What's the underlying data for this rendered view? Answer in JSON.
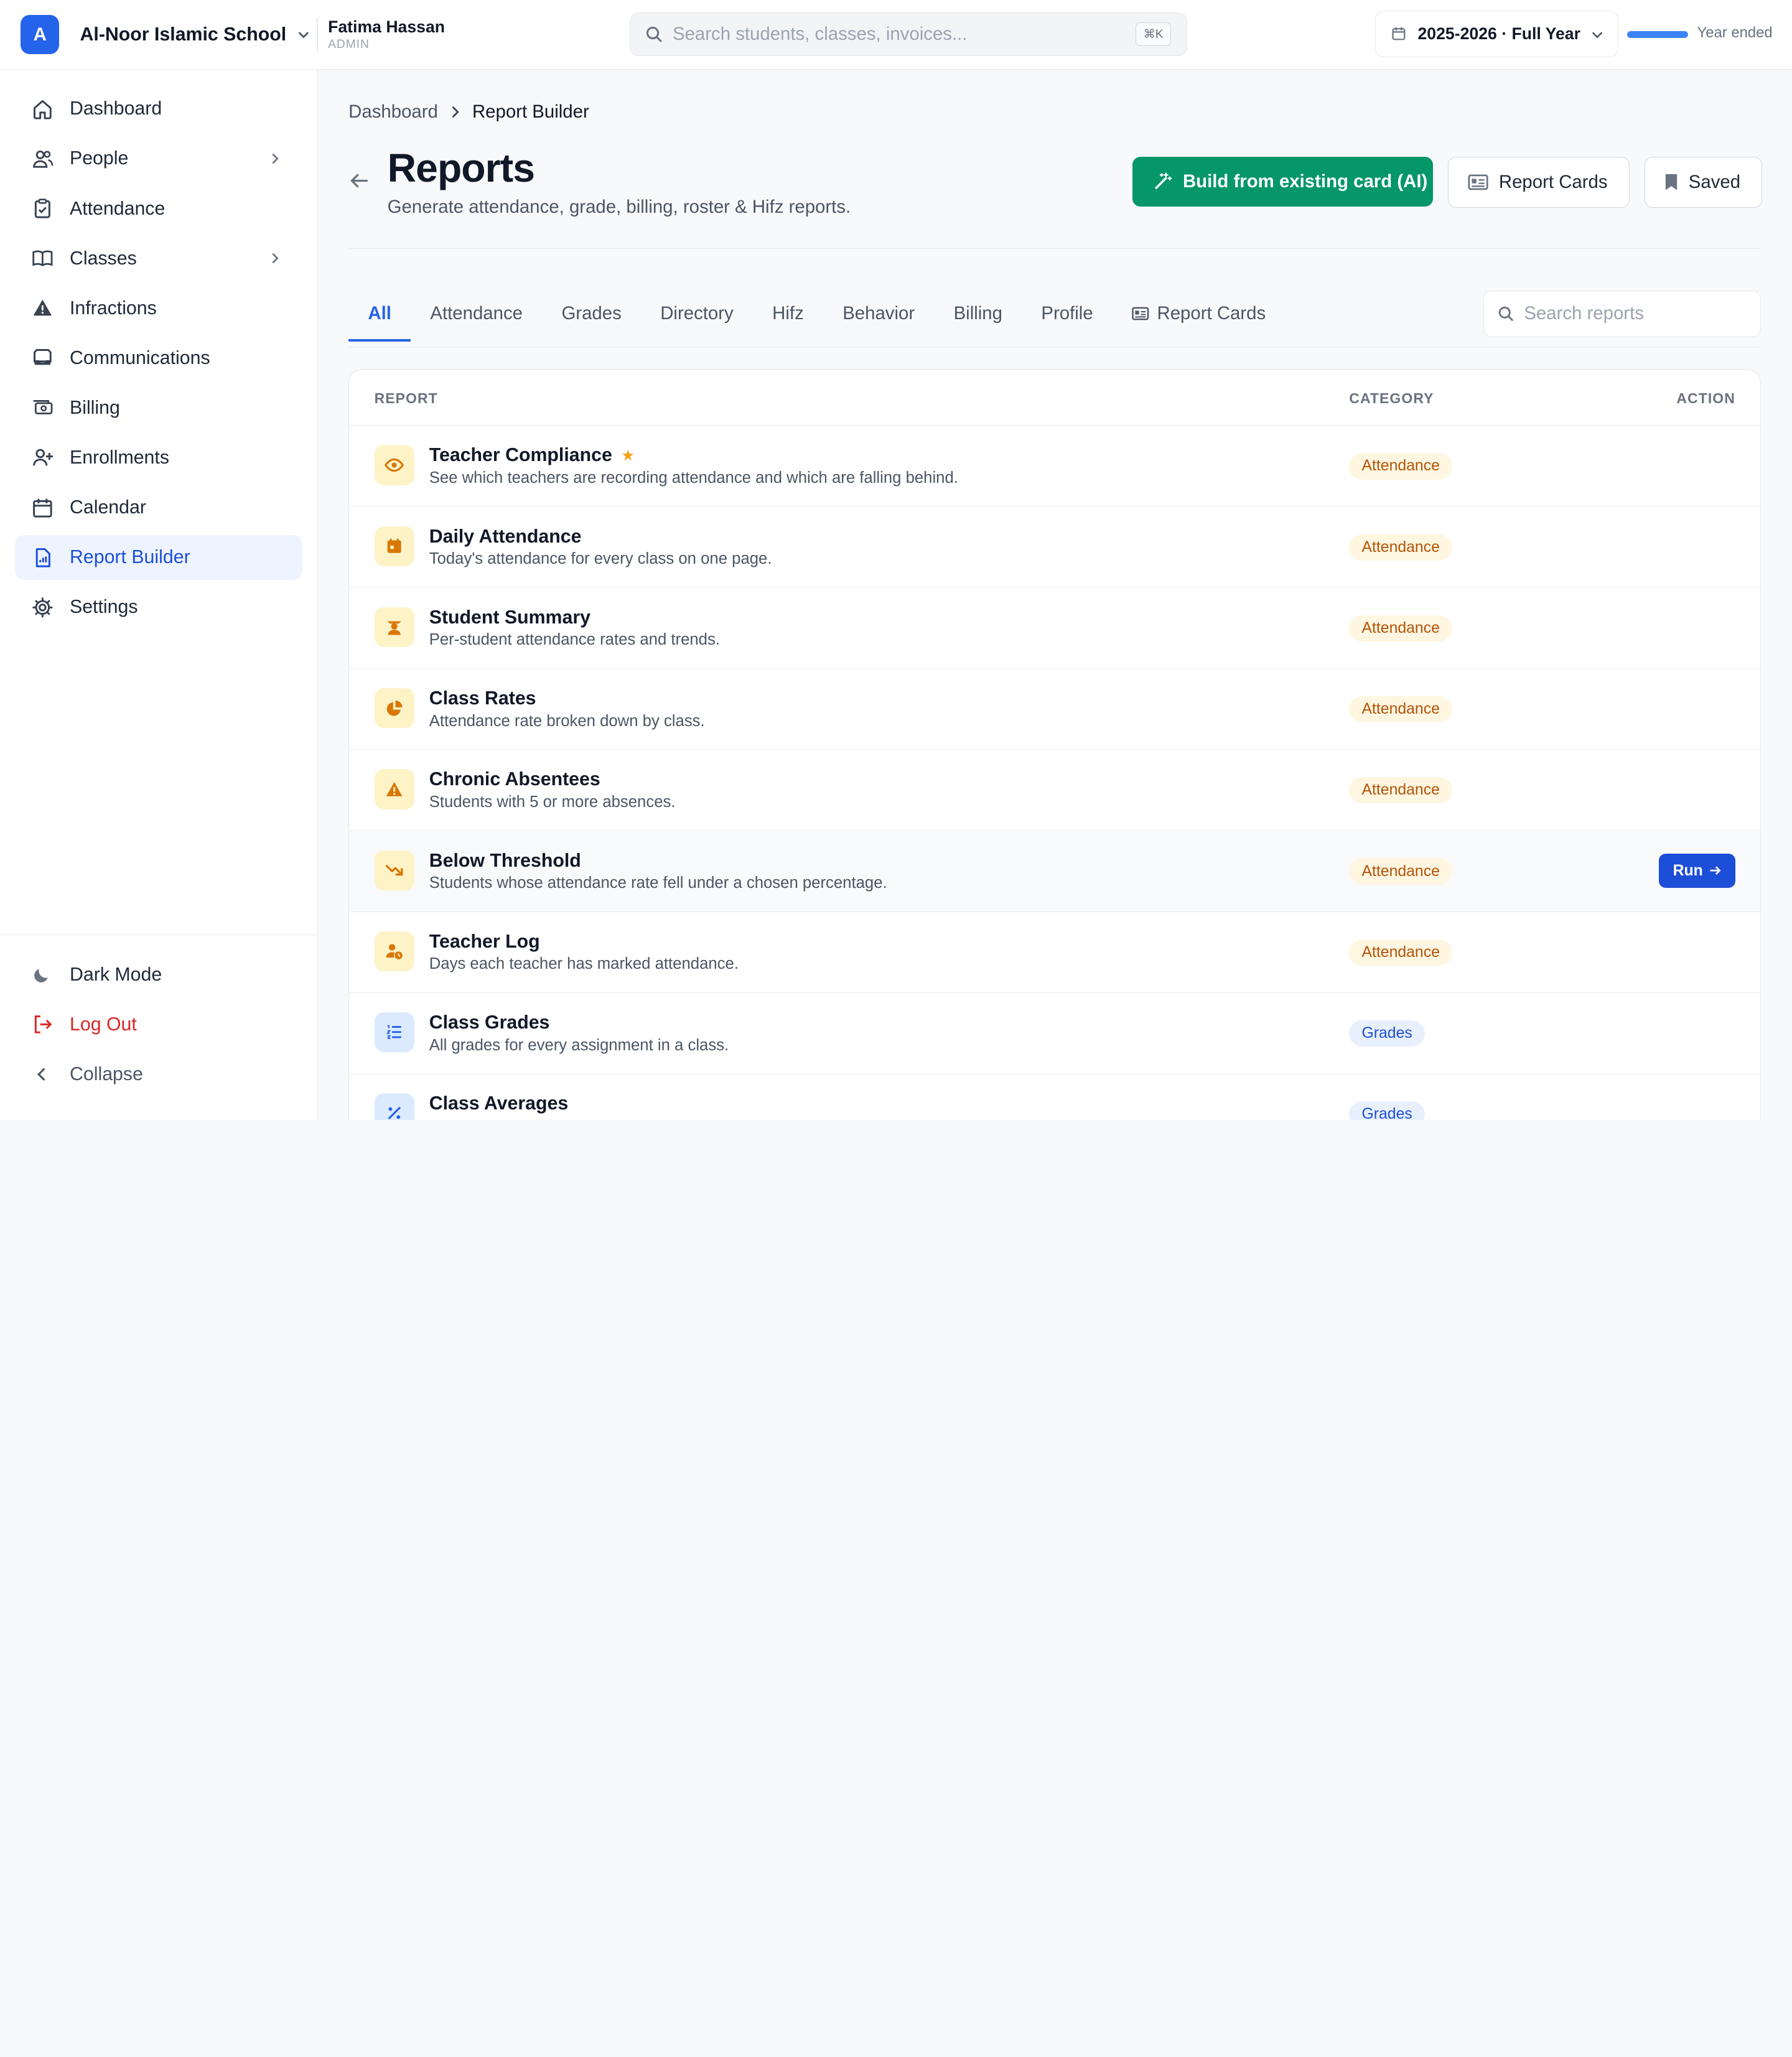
{
  "org": {
    "initial": "A",
    "name": "Al-Noor Islamic School"
  },
  "user": {
    "name": "Fatima Hassan",
    "role": "ADMIN"
  },
  "global_search": {
    "placeholder": "Search students, classes, invoices...",
    "shortcut": "⌘K"
  },
  "year": {
    "label": "2025-2026 · Full Year",
    "status": "Year ended",
    "progress": 1.0
  },
  "sidebar": {
    "items": [
      {
        "label": "Dashboard",
        "icon": "home-icon"
      },
      {
        "label": "People",
        "icon": "users-icon",
        "expandable": true
      },
      {
        "label": "Attendance",
        "icon": "clipboard-check-icon"
      },
      {
        "label": "Classes",
        "icon": "book-icon",
        "expandable": true
      },
      {
        "label": "Infractions",
        "icon": "warning-icon"
      },
      {
        "label": "Communications",
        "icon": "inbox-icon"
      },
      {
        "label": "Billing",
        "icon": "cash-icon"
      },
      {
        "label": "Enrollments",
        "icon": "user-plus-icon"
      },
      {
        "label": "Calendar",
        "icon": "calendar-icon"
      },
      {
        "label": "Report Builder",
        "icon": "report-icon",
        "active": true
      },
      {
        "label": "Settings",
        "icon": "gear-icon"
      }
    ],
    "bottom": {
      "dark_mode": "Dark Mode",
      "logout": "Log Out",
      "collapse": "Collapse"
    }
  },
  "breadcrumb": {
    "parent": "Dashboard",
    "current": "Report Builder"
  },
  "header": {
    "title": "Reports",
    "subtitle": "Generate attendance, grade, billing, roster & Hifz reports.",
    "ai_button": "Build from existing card (AI)",
    "report_cards_button": "Report Cards",
    "saved_button": "Saved"
  },
  "tabs": [
    "All",
    "Attendance",
    "Grades",
    "Directory",
    "Hifz",
    "Behavior",
    "Billing",
    "Profile",
    "Report Cards"
  ],
  "active_tab": "All",
  "report_search": {
    "placeholder": "Search reports"
  },
  "table": {
    "headers": {
      "report": "REPORT",
      "category": "CATEGORY",
      "action": "ACTION"
    },
    "run_label": "Run",
    "rows": [
      {
        "title": "Teacher Compliance",
        "desc": "See which teachers are recording attendance and which are falling behind.",
        "category": "Attendance",
        "icon": "eye-icon",
        "starred": true
      },
      {
        "title": "Daily Attendance",
        "desc": "Today's attendance for every class on one page.",
        "category": "Attendance",
        "icon": "calendar-icon"
      },
      {
        "title": "Student Summary",
        "desc": "Per-student attendance rates and trends.",
        "category": "Attendance",
        "icon": "graduate-icon"
      },
      {
        "title": "Class Rates",
        "desc": "Attendance rate broken down by class.",
        "category": "Attendance",
        "icon": "pie-chart-icon"
      },
      {
        "title": "Chronic Absentees",
        "desc": "Students with 5 or more absences.",
        "category": "Attendance",
        "icon": "warning-icon"
      },
      {
        "title": "Below Threshold",
        "desc": "Students whose attendance rate fell under a chosen percentage.",
        "category": "Attendance",
        "icon": "trending-down-icon",
        "hovered": true
      },
      {
        "title": "Teacher Log",
        "desc": "Days each teacher has marked attendance.",
        "category": "Attendance",
        "icon": "user-clock-icon"
      },
      {
        "title": "Class Grades",
        "desc": "All grades for every assignment in a class.",
        "category": "Grades",
        "icon": "list-icon"
      },
      {
        "title": "Class Averages",
        "desc": "",
        "category": "Grades",
        "icon": "percent-icon"
      }
    ]
  }
}
